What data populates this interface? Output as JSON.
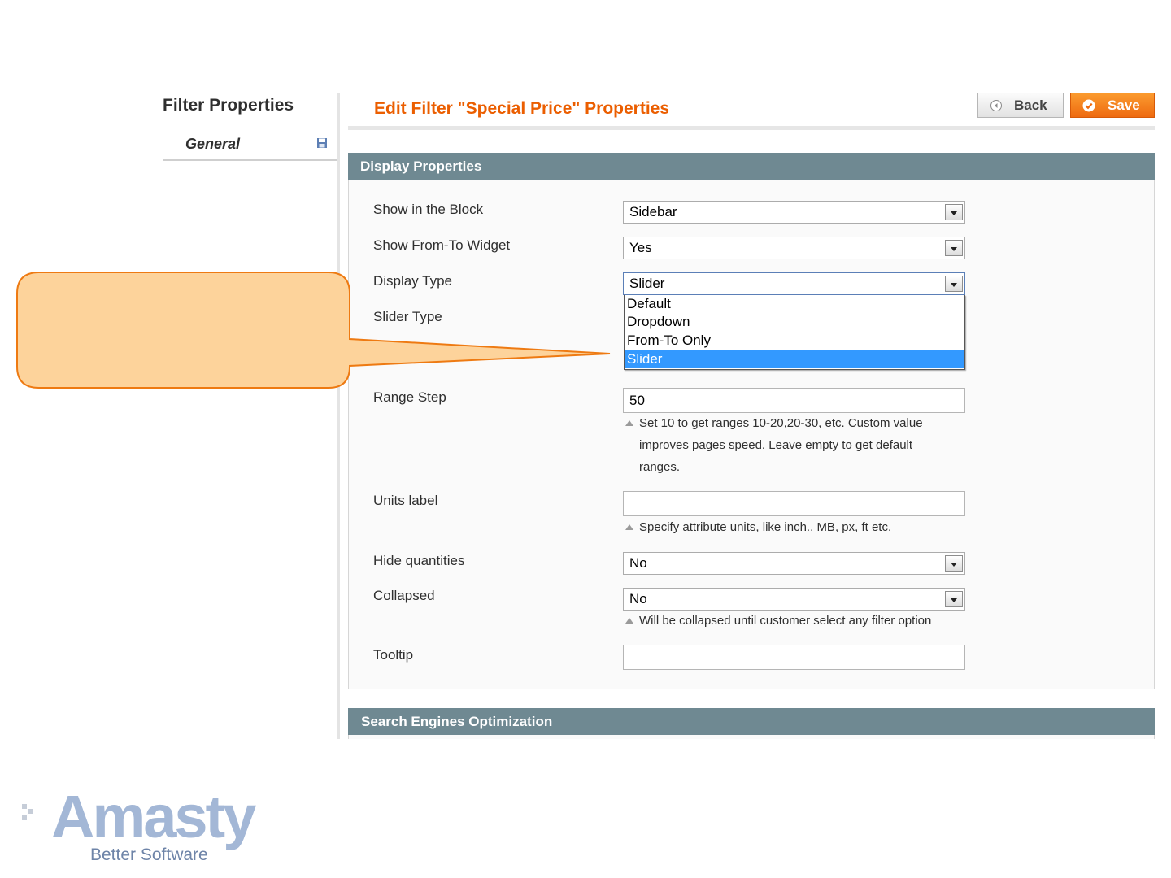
{
  "sidebar": {
    "title": "Filter Properties",
    "tabs": [
      {
        "label": "General",
        "icon": "save-icon"
      }
    ]
  },
  "header": {
    "title": "Edit Filter \"Special Price\" Properties",
    "back_label": "Back",
    "save_label": "Save"
  },
  "display_properties": {
    "title": "Display Properties",
    "show_in_block": {
      "label": "Show in the Block",
      "value": "Sidebar"
    },
    "show_from_to": {
      "label": "Show From-To Widget",
      "value": "Yes"
    },
    "display_type": {
      "label": "Display Type",
      "value": "Slider",
      "options": [
        "Default",
        "Dropdown",
        "From-To Only",
        "Slider"
      ],
      "highlighted": "Slider"
    },
    "slider_type": {
      "label": "Slider Type"
    },
    "range_step": {
      "label": "Range Step",
      "value": "50",
      "note_lines": [
        "Set 10 to get ranges 10-20,20-30, etc. Custom value",
        "improves pages speed. Leave empty to get default",
        "ranges."
      ]
    },
    "units_label": {
      "label": "Units label",
      "value": "",
      "note": "Specify attribute units, like inch., MB, px, ft etc."
    },
    "hide_quantities": {
      "label": "Hide quantities",
      "value": "No"
    },
    "collapsed": {
      "label": "Collapsed",
      "value": "No",
      "note": "Will be collapsed until customer select any filter option"
    },
    "tooltip": {
      "label": "Tooltip",
      "value": ""
    }
  },
  "seo": {
    "title": "Search Engines Optimization"
  },
  "footer": {
    "logo_text": "Amasty",
    "logo_tagline": "Better Software"
  },
  "colors": {
    "accent": "#eb5e00",
    "fieldset_header": "#6f8992",
    "callout_fill": "#fdd39b",
    "callout_stroke": "#ee7a12",
    "selection": "#3399ff"
  }
}
